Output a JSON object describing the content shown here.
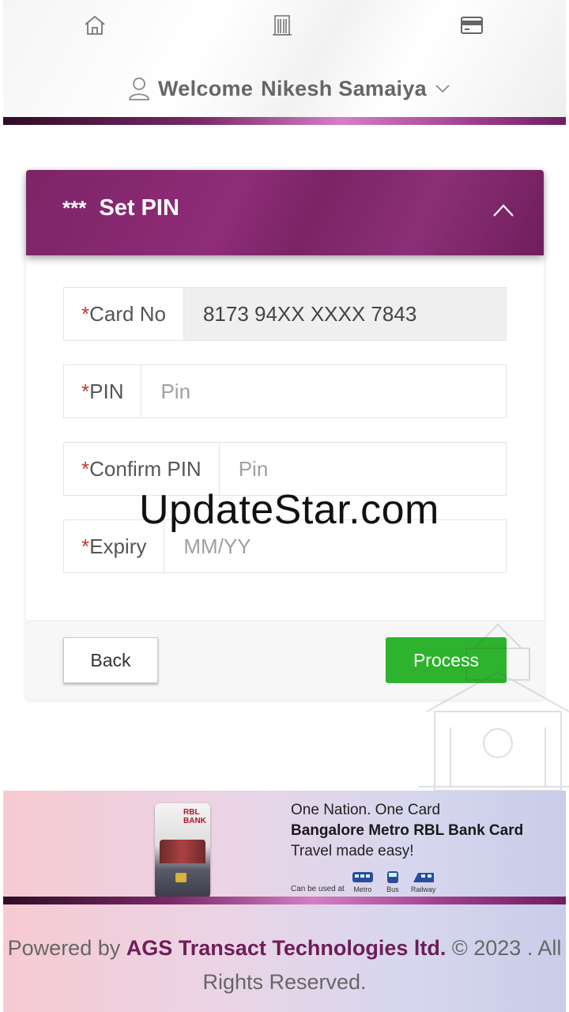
{
  "header": {
    "nav": [
      {
        "icon": "home-icon"
      },
      {
        "icon": "building-icon"
      },
      {
        "icon": "card-icon"
      }
    ],
    "welcome_prefix": "Welcome",
    "user_name": "Nikesh Samaiya"
  },
  "panel": {
    "stars": "***",
    "title": "Set PIN",
    "fields": [
      {
        "required_mark": "*",
        "label": "Card No",
        "value": "8173 94XX XXXX 7843"
      },
      {
        "required_mark": "*",
        "label": "PIN",
        "placeholder": "Pin"
      },
      {
        "required_mark": "*",
        "label": "Confirm PIN",
        "placeholder": "Pin"
      },
      {
        "required_mark": "*",
        "label": "Expiry",
        "placeholder": "MM/YY"
      }
    ],
    "back_label": "Back",
    "process_label": "Process"
  },
  "watermark": "UpdateStar.com",
  "banner": {
    "line1": "One Nation. One Card",
    "line2": "Bangalore Metro RBL Bank Card",
    "line3": "Travel made easy!",
    "can_be_used": "Can be used at",
    "transports": [
      "Metro",
      "Bus",
      "Railway"
    ],
    "card_brand": "RBL BANK"
  },
  "footer": {
    "powered_by": "Powered by",
    "company": "AGS Transact Technologies ltd.",
    "copyright": "© 2023 . All Rights Reserved."
  },
  "colors": {
    "brand_purple": "#7d2466",
    "process_green": "#2db32d",
    "required_red": "#c0392b"
  }
}
